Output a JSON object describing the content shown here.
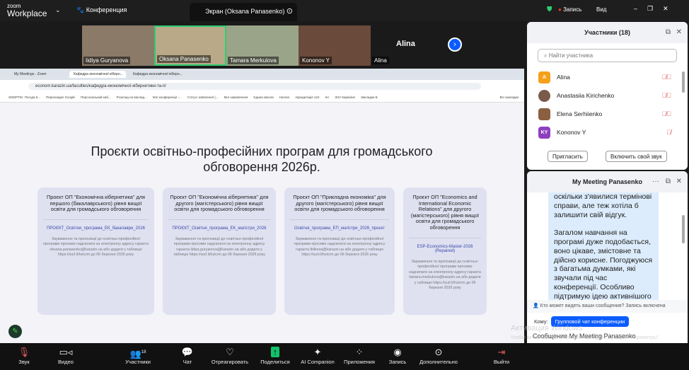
{
  "app": {
    "logo_small": "zoom",
    "logo_big": "Workplace",
    "meeting_menu": "Конференция",
    "screen_tab": "Экран (Oksana Panasenko)",
    "recording": "Запись",
    "view": "Вид"
  },
  "videos": [
    {
      "name": "Iidiya Guryanova"
    },
    {
      "name": "Oksana Panasenko"
    },
    {
      "name": "Tamara Merkulova"
    },
    {
      "name": "Kononov Y"
    },
    {
      "name": "Alina",
      "label": "Alina"
    }
  ],
  "browser": {
    "tabs": [
      "My Meetings - Zoom",
      "Кафедра економічної кіберн...",
      "Кафедра економічної кіберн..."
    ],
    "url": "econom.karazin.ua/faculties/кафедра-економічної-кібернетики-та-п/",
    "bookmarks": [
      "SMOPTIK: Погода в...",
      "Перекладач Google",
      "Персональний каб...",
      "Розклад на вихлад...",
      "Мої конференції -...",
      "Статус заявлення (...",
      "Мої замовлення",
      "Єдина Школа",
      "Human",
      "Акредитація 124",
      "Інт",
      "ЗНУ Караніне",
      "Закладки Б",
      "Всі закладки"
    ]
  },
  "page": {
    "title": "Проєкти освітньо-професійних програм для громадського обговорення 2026р.",
    "cards": [
      {
        "title": "Проєкт ОП \"Економічна кібернетика\" для першого (бакалаврського) рівня вищої освіти для громадського обговорення",
        "link": "ПРОЄКТ_Освітня_програма_ЕК_бакалаври_2026",
        "text": "Зауваження та пропозиції до освітньо-професійної програми просимо надсилати на електронну адресу гаранта oksana.panasenko@karazin.ua або додати у таблицю https://surl.li/hzicrm до 06 березня 2026 року"
      },
      {
        "title": "Проєкт ОП \"Економічна кібернетика\" для другого (магістерського) рівня вищої освіти для громадського обговорення",
        "link": "ПРОЄКТ_Освітня_програма_ЕК_магістри_2026",
        "text": "Зауваження та пропозиції до освітньо-професійної програми просимо надсилати на електронну адресу гаранта lidiya.guryanova@karazin.ua або додати у таблицю https://surl.li/hzicrm до 06 березня 2026 року"
      },
      {
        "title": "Проєкт ОП \"Прикладна економіка\" для другого (магістерського) рівня вищої освіти для громадського обговорення",
        "link": "Освітня_програма_ЕП_магістри_2026_проєкт",
        "text": "Зауваження та пропозиції до освітньо-професійної програми просимо надсилати на електронну адресу гаранта lbilkova@karazin.ua або додати у таблицю https://surl.li/hzicrm до 06 березня 2026 року"
      },
      {
        "title": "Проєкт ОП \"Economics and International Economic Relations\" для другого (магістерського) рівня вищої освіти для громадського обговорення",
        "link": "ESP-Economics-Master-2026 (Repaired)",
        "text": "Зауваження та пропозиції до освітньо-професійної програми просимо надсилати на електронну адресу гаранта tamara.merkulova@karazin.ua або додати у таблицю https://surl.li/hzicrm до 06 березня 2026 року"
      }
    ]
  },
  "participants": {
    "title": "Участники (18)",
    "search_placeholder": "Найти участника",
    "items": [
      {
        "initials": "A",
        "name": "Alina",
        "color": "#f5a01a"
      },
      {
        "initials": "",
        "name": "Anastasiia Kirichenko",
        "color": "#7a5a4a"
      },
      {
        "initials": "",
        "name": "Elena Serhiienko",
        "color": "#8a6040"
      },
      {
        "initials": "KY",
        "name": "Kononov Y",
        "color": "#8e3fbf"
      }
    ],
    "invite": "Пригласить",
    "unmute": "Включить свой звук"
  },
  "chat": {
    "title": "My Meeting Panasenko",
    "message": "оскільки з'явилися термінові справи, але теж хотіла б залишити свій відгук.\n\nЗагалом навчання на програмі дуже подобається, воно цікаве, змістовне та дійсно корисне. Погоджуюся з багатьма думками, які звучали під час конференції. Особливо підтримую ідею активнішого впровадження інструментів штучного інтелекту",
    "notice": "Кто может видеть ваши сообщения? Запись включена",
    "to_label": "Кому:",
    "to_value": "Групповой чат конференции",
    "input_placeholder": "Сообщение My Meeting Panasenko"
  },
  "watermark": {
    "line1": "Активация Windows",
    "line2": "Чтобы активировать Windows, перейдите в раздел \"Параметры\"."
  },
  "toolbar": [
    {
      "label": "Звук",
      "icon": "mic-muted-icon"
    },
    {
      "label": "Видео",
      "icon": "video-icon"
    },
    {
      "label": "Участники",
      "icon": "participants-icon",
      "count": "18"
    },
    {
      "label": "Чат",
      "icon": "chat-icon"
    },
    {
      "label": "Отреагировать",
      "icon": "heart-icon"
    },
    {
      "label": "Поделиться",
      "icon": "share-icon"
    },
    {
      "label": "AI Companion",
      "icon": "sparkle-icon"
    },
    {
      "label": "Приложения",
      "icon": "apps-icon"
    },
    {
      "label": "Запись",
      "icon": "record-icon"
    },
    {
      "label": "Дополнительно",
      "icon": "more-icon"
    },
    {
      "label": "Выйти",
      "icon": "leave-icon"
    }
  ],
  "colors": {
    "accent": "#0b5cff",
    "active_speaker": "#2ecc71",
    "muted": "#e05a5a",
    "share": "#12c26a"
  }
}
